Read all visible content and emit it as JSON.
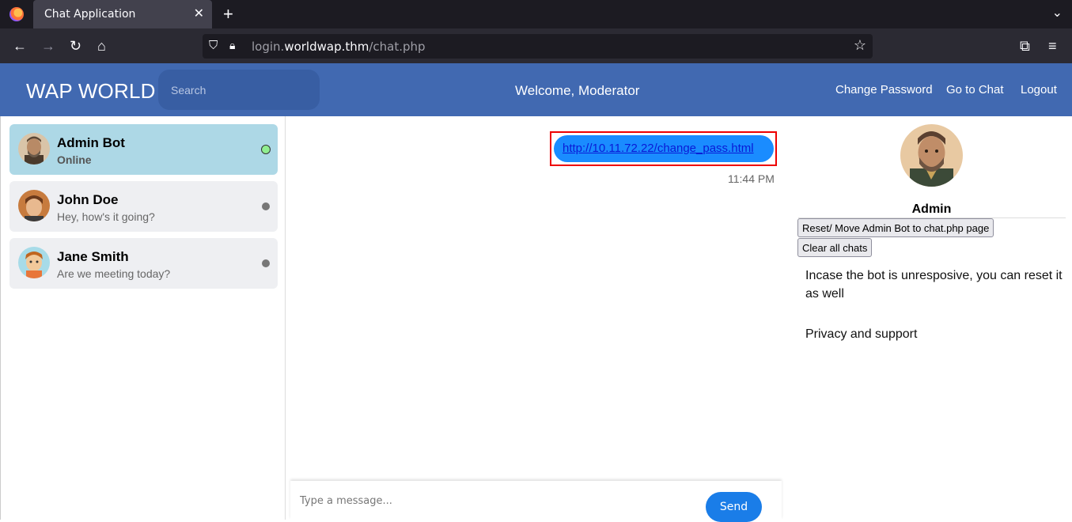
{
  "browser": {
    "tab_title": "Chat Application",
    "url_prefix": "login.",
    "url_host": "worldwap.thm",
    "url_path": "/chat.php"
  },
  "header": {
    "brand": "WAP WORLD",
    "search_placeholder": "Search",
    "welcome": "Welcome, Moderator",
    "links": [
      "Change Password",
      "Go to Chat",
      "Logout"
    ],
    "color": "#4169b1"
  },
  "contacts": [
    {
      "name": "Admin Bot",
      "status": "Online",
      "online": true
    },
    {
      "name": "John Doe",
      "status": "Hey, how's it going?",
      "online": false
    },
    {
      "name": "Jane Smith",
      "status": "Are we meeting today?",
      "online": false
    }
  ],
  "chat": {
    "messages": [
      {
        "text": "http://10.11.72.22/change_pass.html",
        "time": "11:44 PM"
      }
    ],
    "input_placeholder": "Type a message...",
    "send_label": "Send"
  },
  "profile": {
    "name": "Admin",
    "reset_button": "Reset/ Move Admin Bot to chat.php page",
    "clear_button": "Clear all chats",
    "note": "Incase the bot is unresposive, you can reset it as well",
    "footer_link": "Privacy and support"
  }
}
